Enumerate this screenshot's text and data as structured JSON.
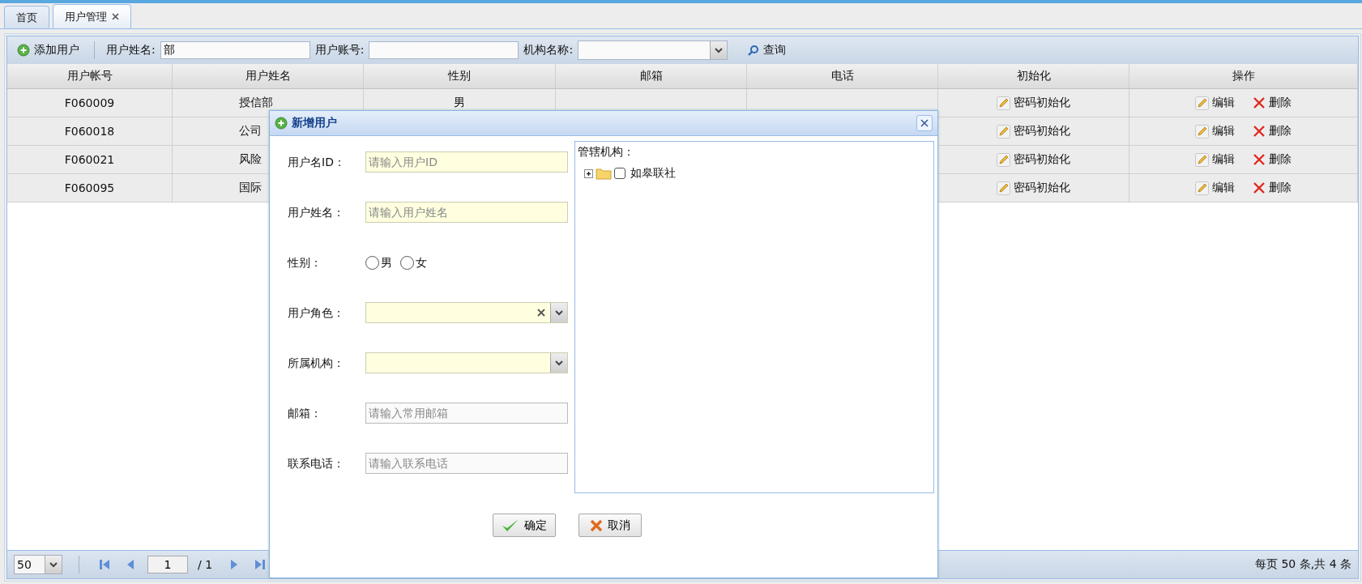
{
  "tabs": [
    {
      "label": "首页",
      "selected": false,
      "closable": false
    },
    {
      "label": "用户管理",
      "selected": true,
      "closable": true
    }
  ],
  "toolbar": {
    "add_button": "添加用户",
    "filters": [
      {
        "label": "用户姓名:",
        "kind": "text",
        "value": "部"
      },
      {
        "label": "用户账号:",
        "kind": "text"
      },
      {
        "label": "机构名称:",
        "kind": "select"
      }
    ],
    "search_button": "查询"
  },
  "table": {
    "columns": [
      "用户帐号",
      "用户姓名",
      "性别",
      "邮箱",
      "电话",
      "初始化",
      "操作"
    ],
    "rows": [
      {
        "account": "F060009",
        "name": "授信部",
        "gender": "男",
        "reset": "密码初始化",
        "edit": "编辑",
        "delete": "删除"
      },
      {
        "account": "F060018",
        "name": "公司",
        "reset": "密码初始化",
        "edit": "编辑",
        "delete": "删除"
      },
      {
        "account": "F060021",
        "name": "风险",
        "reset": "密码初始化",
        "edit": "编辑",
        "delete": "删除"
      },
      {
        "account": "F060095",
        "name": "国际",
        "reset": "密码初始化",
        "edit": "编辑",
        "delete": "删除"
      }
    ]
  },
  "pager": {
    "page_size": "50",
    "page": "1",
    "total_pages": "/ 1",
    "summary": "每页 50 条,共 4 条"
  },
  "dialog": {
    "title": "新增用户",
    "fields": [
      {
        "label": "用户名ID：",
        "kind": "text",
        "placeholder": "请输入用户ID",
        "required": true
      },
      {
        "label": "用户姓名：",
        "kind": "text",
        "placeholder": "请输入用户姓名",
        "required": true
      },
      {
        "label": "性别：",
        "kind": "radio",
        "options": [
          {
            "label": "男",
            "selected": false
          },
          {
            "label": "女",
            "selected": false
          }
        ]
      },
      {
        "label": "用户角色：",
        "kind": "select",
        "required": true,
        "clearable": true
      },
      {
        "label": "所属机构：",
        "kind": "select",
        "required": true,
        "clearable": false
      },
      {
        "label": "邮箱：",
        "kind": "text",
        "placeholder": "请输入常用邮箱",
        "required": false
      },
      {
        "label": "联系电话：",
        "kind": "text",
        "placeholder": "请输入联系电话",
        "required": false
      }
    ],
    "tree": {
      "label": "管辖机构：",
      "nodes": [
        {
          "label": "如皋联社",
          "expanded": false,
          "checked": false
        }
      ]
    },
    "ok_button": "确定",
    "cancel_button": "取消"
  }
}
